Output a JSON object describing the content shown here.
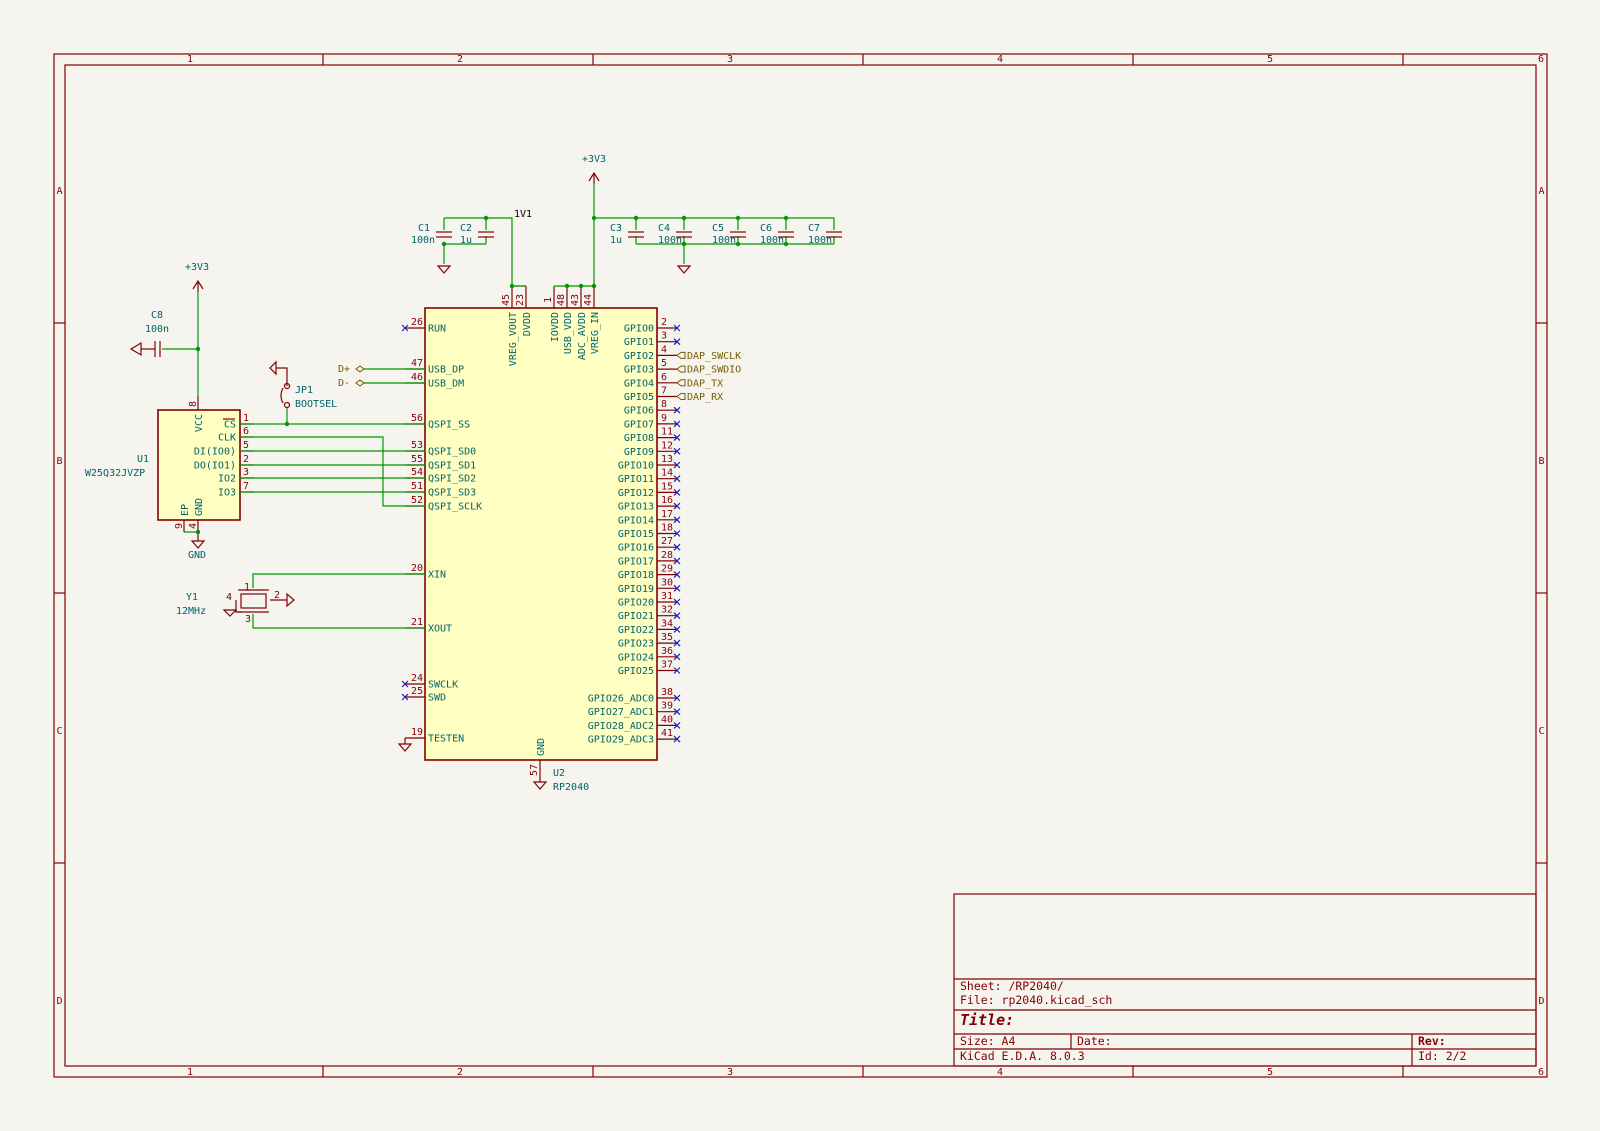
{
  "zones_h": [
    "1",
    "2",
    "3",
    "4",
    "5",
    "6"
  ],
  "zones_v": [
    "A",
    "B",
    "C",
    "D"
  ],
  "title_block": {
    "sheet": "Sheet: /RP2040/",
    "file": "File: rp2040.kicad_sch",
    "title": "Title:",
    "size": "Size: A4",
    "date": "Date:",
    "rev": "Rev:",
    "kicad": "KiCad E.D.A. 8.0.3",
    "id": "Id: 2/2"
  },
  "power": {
    "p3v3_a": "+3V3",
    "p3v3_b": "+3V3",
    "gnd": "GND",
    "net_1v1": "1V1"
  },
  "caps": [
    {
      "ref": "C1",
      "val": "100n"
    },
    {
      "ref": "C2",
      "val": "1u"
    },
    {
      "ref": "C3",
      "val": "1u"
    },
    {
      "ref": "C4",
      "val": "100n"
    },
    {
      "ref": "C5",
      "val": "100n"
    },
    {
      "ref": "C6",
      "val": "100n"
    },
    {
      "ref": "C7",
      "val": "100n"
    },
    {
      "ref": "C8",
      "val": "100n"
    }
  ],
  "jp1": {
    "ref": "JP1",
    "val": "BOOTSEL"
  },
  "y1": {
    "ref": "Y1",
    "val": "12MHz"
  },
  "u1": {
    "ref": "U1",
    "val": "W25Q32JVZP",
    "pins_right": [
      [
        "CS",
        "1"
      ],
      [
        "CLK",
        "6"
      ],
      [
        "DI(IO0)",
        "5"
      ],
      [
        "DO(IO1)",
        "2"
      ],
      [
        "IO2",
        "3"
      ],
      [
        "IO3",
        "7"
      ]
    ],
    "vcc": [
      "VCC",
      "8"
    ],
    "gnd": [
      "GND",
      "4"
    ],
    "ep": [
      "EP",
      "9"
    ]
  },
  "u2": {
    "ref": "U2",
    "val": "RP2040",
    "left": [
      [
        "RUN",
        "26"
      ],
      [
        "USB_DP",
        "47"
      ],
      [
        "USB_DM",
        "46"
      ],
      [
        "QSPI_SS",
        "56"
      ],
      [
        "QSPI_SD0",
        "53"
      ],
      [
        "QSPI_SD1",
        "55"
      ],
      [
        "QSPI_SD2",
        "54"
      ],
      [
        "QSPI_SD3",
        "51"
      ],
      [
        "QSPI_SCLK",
        "52"
      ],
      [
        "XIN",
        "20"
      ],
      [
        "XOUT",
        "21"
      ],
      [
        "SWCLK",
        "24"
      ],
      [
        "SWD",
        "25"
      ],
      [
        "TESTEN",
        "19"
      ]
    ],
    "top": [
      [
        "VREG_VOUT",
        "45"
      ],
      [
        "DVDD",
        "23"
      ],
      [
        "IOVDD",
        "1"
      ],
      [
        "USB_VDD",
        "48"
      ],
      [
        "ADC_AVDD",
        "43"
      ],
      [
        "VREG_IN",
        "44"
      ]
    ],
    "right": [
      [
        "GPIO0",
        "2"
      ],
      [
        "GPIO1",
        "3"
      ],
      [
        "GPIO2",
        "4"
      ],
      [
        "GPIO3",
        "5"
      ],
      [
        "GPIO4",
        "6"
      ],
      [
        "GPIO5",
        "7"
      ],
      [
        "GPIO6",
        "8"
      ],
      [
        "GPIO7",
        "9"
      ],
      [
        "GPIO8",
        "11"
      ],
      [
        "GPIO9",
        "12"
      ],
      [
        "GPIO10",
        "13"
      ],
      [
        "GPIO11",
        "14"
      ],
      [
        "GPIO12",
        "15"
      ],
      [
        "GPIO13",
        "16"
      ],
      [
        "GPIO14",
        "17"
      ],
      [
        "GPIO15",
        "18"
      ],
      [
        "GPIO16",
        "27"
      ],
      [
        "GPIO17",
        "28"
      ],
      [
        "GPIO18",
        "29"
      ],
      [
        "GPIO19",
        "30"
      ],
      [
        "GPIO20",
        "31"
      ],
      [
        "GPIO21",
        "32"
      ],
      [
        "GPIO22",
        "34"
      ],
      [
        "GPIO23",
        "35"
      ],
      [
        "GPIO24",
        "36"
      ],
      [
        "GPIO25",
        "37"
      ],
      [
        "GPIO26_ADC0",
        "38"
      ],
      [
        "GPIO27_ADC1",
        "39"
      ],
      [
        "GPIO28_ADC2",
        "40"
      ],
      [
        "GPIO29_ADC3",
        "41"
      ]
    ],
    "bottom": [
      [
        "GND",
        "57"
      ]
    ]
  },
  "labels": {
    "dp": "D+",
    "dm": "D-",
    "swclk": "DAP_SWCLK",
    "swdio": "DAP_SWDIO",
    "tx": "DAP_TX",
    "rx": "DAP_RX"
  }
}
